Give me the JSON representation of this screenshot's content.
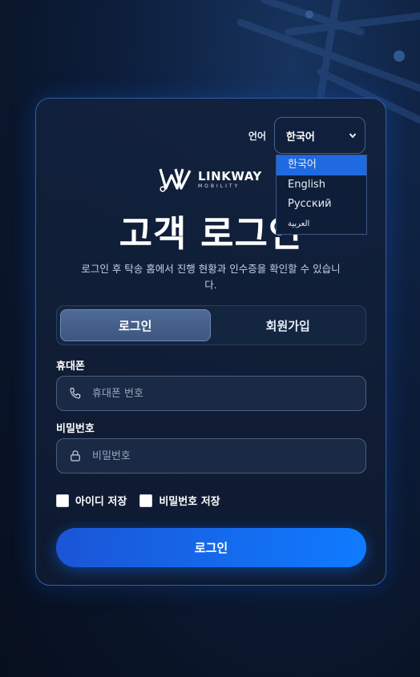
{
  "language": {
    "label": "언어",
    "selected": "한국어",
    "options": [
      "한국어",
      "English",
      "Русский",
      "العربية"
    ]
  },
  "logo": {
    "name": "LINKWAY",
    "sub": "MOBILITY"
  },
  "title": "고객 로그인",
  "subtitle": "로그인 후 탁송 홈에서 진행 현황과 인수증을 확인할 수 있습니다.",
  "tabs": {
    "login": "로그인",
    "signup": "회원가입"
  },
  "phone": {
    "label": "휴대폰",
    "placeholder": "휴대폰 번호",
    "icon": "phone-icon"
  },
  "password": {
    "label": "비밀번호",
    "placeholder": "비밀번호",
    "icon": "lock-icon"
  },
  "checks": {
    "save_id": "아이디 저장",
    "save_password": "비밀번호 저장"
  },
  "submit": "로그인",
  "colors": {
    "accent": "#1f6ae0",
    "button_start": "#1b55d6",
    "button_end": "#0f7bff",
    "card_border": "#2f5fa8"
  }
}
